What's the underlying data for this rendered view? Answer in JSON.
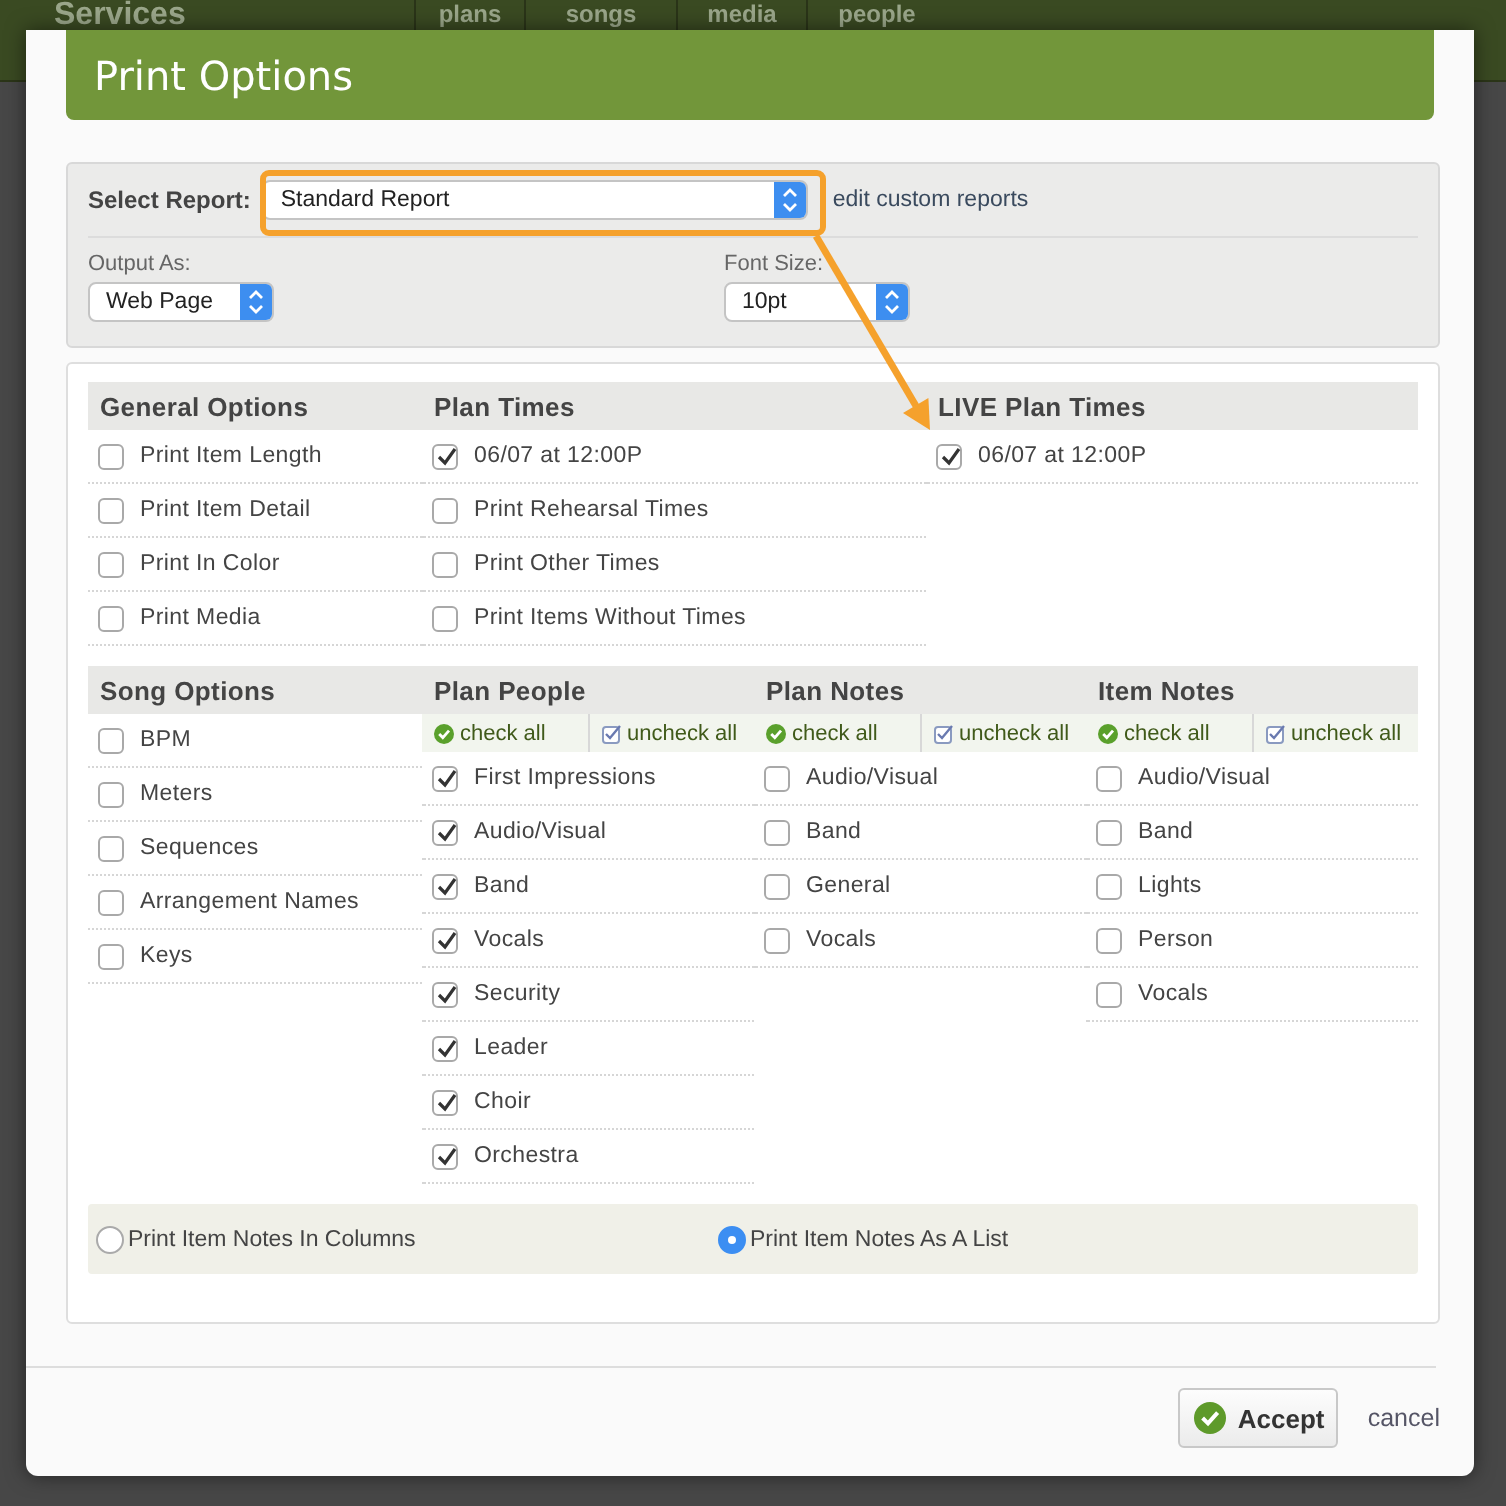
{
  "app_bar": {
    "title": "Services",
    "tabs": [
      {
        "label": "plans"
      },
      {
        "label": "songs"
      },
      {
        "label": "media"
      },
      {
        "label": "people"
      }
    ]
  },
  "dialog": {
    "title": "Print Options",
    "report": {
      "label": "Select Report:",
      "value": "Standard Report",
      "link": "edit custom reports"
    },
    "output": {
      "label": "Output As:",
      "value": "Web Page"
    },
    "font_size": {
      "label": "Font Size:",
      "value": "10pt"
    },
    "groups": [
      {
        "columns": [
          {
            "title": "General Options",
            "items": [
              {
                "label": "Print Item Length",
                "checked": false
              },
              {
                "label": "Print Item Detail",
                "checked": false
              },
              {
                "label": "Print In Color",
                "checked": false
              },
              {
                "label": "Print Media",
                "checked": false
              }
            ]
          },
          {
            "title": "Plan Times",
            "items": [
              {
                "label": "06/07 at 12:00P",
                "checked": true
              },
              {
                "label": "Print Rehearsal Times",
                "checked": false
              },
              {
                "label": "Print Other Times",
                "checked": false
              },
              {
                "label": "Print Items Without Times",
                "checked": false
              }
            ]
          },
          {
            "title": "LIVE Plan Times",
            "items": [
              {
                "label": "06/07 at 12:00P",
                "checked": true
              }
            ]
          }
        ]
      },
      {
        "columns": [
          {
            "title": "Song Options",
            "items": [
              {
                "label": "BPM",
                "checked": false
              },
              {
                "label": "Meters",
                "checked": false
              },
              {
                "label": "Sequences",
                "checked": false
              },
              {
                "label": "Arrangement Names",
                "checked": false
              },
              {
                "label": "Keys",
                "checked": false
              }
            ]
          },
          {
            "title": "Plan People",
            "bulk": {
              "check": "check all",
              "uncheck": "uncheck all"
            },
            "items": [
              {
                "label": "First Impressions",
                "checked": true
              },
              {
                "label": "Audio/Visual",
                "checked": true
              },
              {
                "label": "Band",
                "checked": true
              },
              {
                "label": "Vocals",
                "checked": true
              },
              {
                "label": "Security",
                "checked": true
              },
              {
                "label": "Leader",
                "checked": true
              },
              {
                "label": "Choir",
                "checked": true
              },
              {
                "label": "Orchestra",
                "checked": true
              }
            ]
          },
          {
            "title": "Plan Notes",
            "bulk": {
              "check": "check all",
              "uncheck": "uncheck all"
            },
            "items": [
              {
                "label": "Audio/Visual",
                "checked": false
              },
              {
                "label": "Band",
                "checked": false
              },
              {
                "label": "General",
                "checked": false
              },
              {
                "label": "Vocals",
                "checked": false
              }
            ]
          },
          {
            "title": "Item Notes",
            "bulk": {
              "check": "check all",
              "uncheck": "uncheck all"
            },
            "items": [
              {
                "label": "Audio/Visual",
                "checked": false
              },
              {
                "label": "Band",
                "checked": false
              },
              {
                "label": "Lights",
                "checked": false
              },
              {
                "label": "Person",
                "checked": false
              },
              {
                "label": "Vocals",
                "checked": false
              }
            ]
          }
        ]
      }
    ],
    "note_layout": [
      {
        "label": "Print Item Notes In Columns",
        "selected": false
      },
      {
        "label": "Print Item Notes As A List",
        "selected": true
      }
    ],
    "accept": "Accept",
    "cancel": "cancel"
  }
}
